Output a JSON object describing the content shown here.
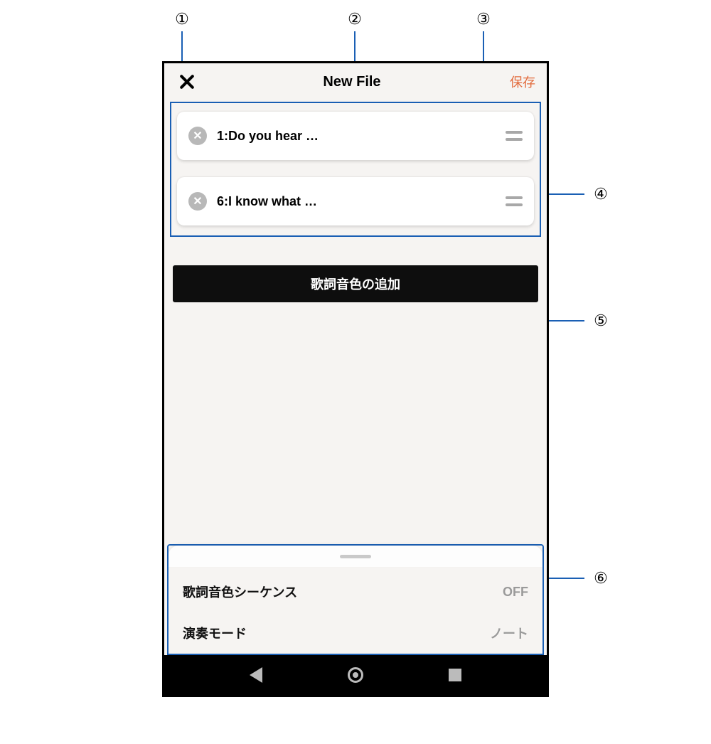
{
  "header": {
    "title": "New File",
    "save_label": "保存"
  },
  "tones": [
    {
      "label": "1:Do you hear …"
    },
    {
      "label": "6:I know what …"
    }
  ],
  "add_button": {
    "label": "歌詞音色の追加"
  },
  "settings": {
    "sequence": {
      "label": "歌詞音色シーケンス",
      "value": "OFF"
    },
    "play_mode": {
      "label": "演奏モード",
      "value": "ノート"
    }
  },
  "callouts": {
    "1": "①",
    "2": "②",
    "3": "③",
    "4": "④",
    "5": "⑤",
    "6": "⑥"
  }
}
